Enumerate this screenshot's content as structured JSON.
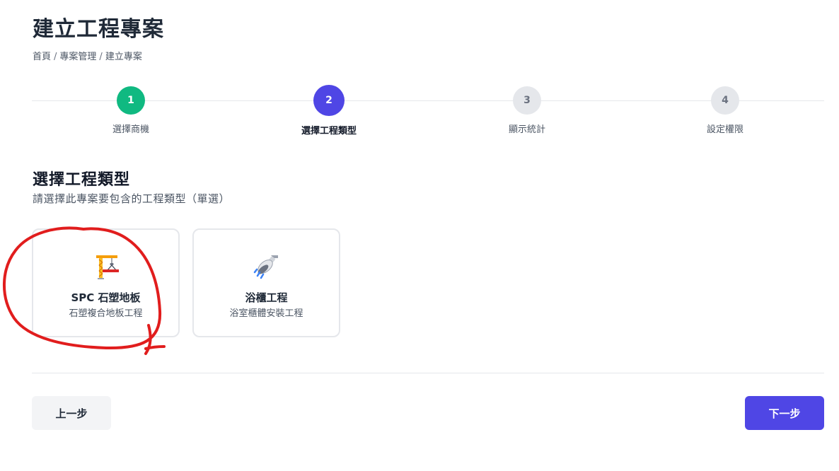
{
  "page": {
    "title": "建立工程專案"
  },
  "breadcrumb": {
    "items": [
      "首頁",
      "專案管理",
      "建立專案"
    ],
    "separator": "/"
  },
  "stepper": {
    "steps": [
      {
        "number": "1",
        "label": "選擇商機",
        "state": "done"
      },
      {
        "number": "2",
        "label": "選擇工程類型",
        "state": "active"
      },
      {
        "number": "3",
        "label": "顯示統計",
        "state": "todo"
      },
      {
        "number": "4",
        "label": "設定權限",
        "state": "todo"
      }
    ]
  },
  "section": {
    "title": "選擇工程類型",
    "subtitle": "請選擇此專案要包含的工程類型（單選）"
  },
  "project_types": [
    {
      "icon": "construction-crane-icon",
      "title": "SPC 石塑地板",
      "description": "石塑複合地板工程"
    },
    {
      "icon": "shower-head-icon",
      "title": "浴櫃工程",
      "description": "浴室櫃體安裝工程"
    }
  ],
  "footer": {
    "prev_label": "上一步",
    "next_label": "下一步"
  },
  "colors": {
    "primary": "#4f46e5",
    "success": "#10b981",
    "annotation": "#e11d1d"
  }
}
